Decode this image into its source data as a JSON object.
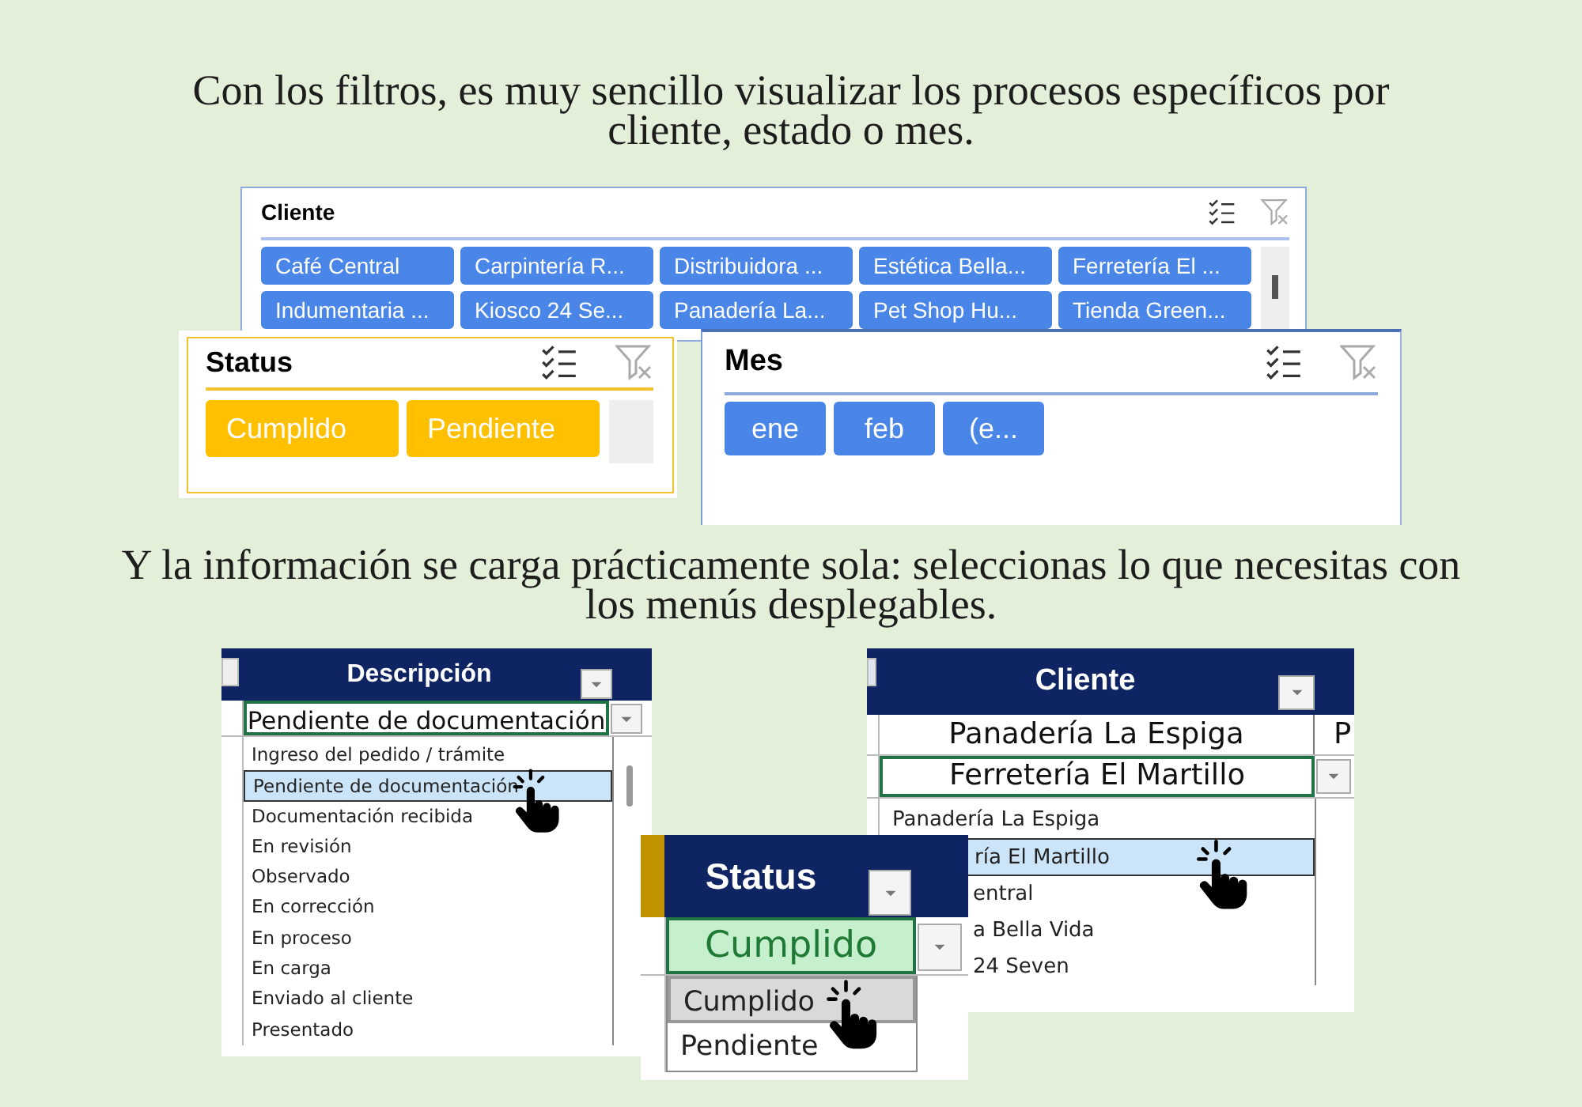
{
  "captions": [
    "Con los filtros, es muy sencillo visualizar los procesos específicos por cliente, estado o mes.",
    "Y la información se carga prácticamente sola: seleccionas lo que necesitas con los menús desplegables."
  ],
  "slicers": [
    {
      "title": "Cliente",
      "color": "#4a86e8",
      "items": [
        {
          "label": "Café Central",
          "selected": true
        },
        {
          "label": "Carpintería R...",
          "selected": true
        },
        {
          "label": "Distribuidora ...",
          "selected": true
        },
        {
          "label": "Estética Bella...",
          "selected": true
        },
        {
          "label": "Ferretería El ...",
          "selected": true
        },
        {
          "label": "Indumentaria ...",
          "selected": true
        },
        {
          "label": "Kiosco 24 Se...",
          "selected": true
        },
        {
          "label": "Panadería La...",
          "selected": true
        },
        {
          "label": "Pet Shop Hu...",
          "selected": true
        },
        {
          "label": "Tienda Green...",
          "selected": true
        }
      ]
    },
    {
      "title": "Status",
      "color": "#ffc000",
      "items": [
        {
          "label": "Cumplido",
          "selected": true
        },
        {
          "label": "Pendiente",
          "selected": true
        }
      ]
    },
    {
      "title": "Mes",
      "color": "#4a86e8",
      "items": [
        {
          "label": "ene",
          "selected": true
        },
        {
          "label": "feb",
          "selected": true
        },
        {
          "label": "(e...",
          "selected": true
        }
      ]
    }
  ],
  "tables": [
    {
      "header": "Descripción",
      "cell": "Pendiente de documentación",
      "options": [
        {
          "label": "Ingreso del pedido / trámite",
          "selected": false
        },
        {
          "label": "Pendiente de documentación",
          "selected": true
        },
        {
          "label": "Documentación recibida",
          "selected": false
        },
        {
          "label": "En revisión",
          "selected": false
        },
        {
          "label": "Observado",
          "selected": false
        },
        {
          "label": "En corrección",
          "selected": false
        },
        {
          "label": "En proceso",
          "selected": false
        },
        {
          "label": "En carga",
          "selected": false
        },
        {
          "label": "Enviado al cliente",
          "selected": false
        },
        {
          "label": "Presentado",
          "selected": false
        }
      ]
    },
    {
      "header": "Cliente",
      "above_cell": "Panadería La Espiga",
      "next_column_cell": "P",
      "cell": "Ferretería El Martillo",
      "options": [
        {
          "label": "Panadería La Espiga",
          "selected": false
        },
        {
          "label": "ría El Martillo",
          "selected": true,
          "clipped": true
        },
        {
          "label": "entral",
          "selected": false,
          "clipped": true
        },
        {
          "label": "a Bella Vida",
          "selected": false,
          "clipped": true
        },
        {
          "label": "24 Seven",
          "selected": false,
          "clipped": true
        }
      ]
    },
    {
      "header": "Status",
      "cell": "Cumplido",
      "options": [
        {
          "label": "Cumplido",
          "selected": true
        },
        {
          "label": "Pendiente",
          "selected": false
        }
      ]
    }
  ]
}
